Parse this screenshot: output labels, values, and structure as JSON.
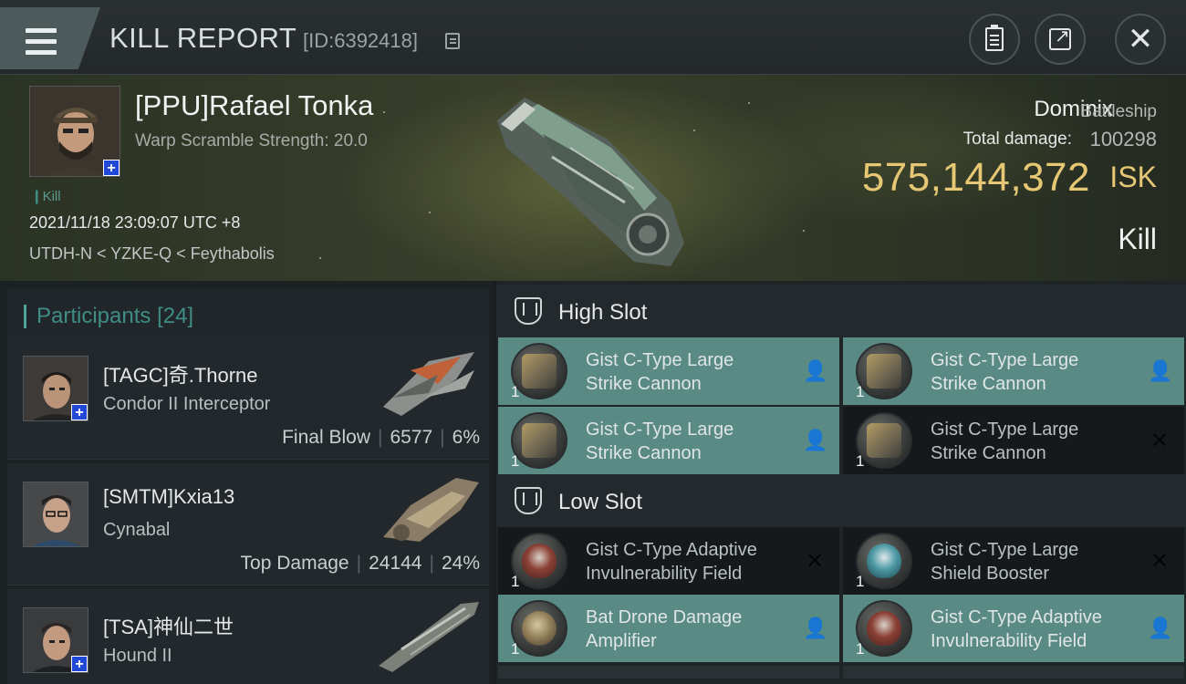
{
  "header": {
    "title": "KILL REPORT",
    "report_id": "[ID:6392418]",
    "menu_icon": "hamburger-menu-icon",
    "buttons": [
      "clipboard-icon",
      "share-icon",
      "close-icon"
    ]
  },
  "victim": {
    "name": "[PPU]Rafael Tonka",
    "warp_scramble": "Warp Scramble Strength: 20.0",
    "kill_tag": "Kill",
    "datetime": "2021/11/18 23:09:07 UTC +8",
    "location": "UTDH-N < YZKE-Q < Feythabolis",
    "ship_name": "Dominix",
    "ship_class": "Battleship",
    "total_damage_label": "Total damage:",
    "total_damage_value": "100298",
    "isk_value": "575,144,372",
    "isk_unit": "ISK",
    "result": "Kill"
  },
  "participants": {
    "label": "Participants",
    "count": "[24]",
    "rows": [
      {
        "name": "[TAGC]奇.Thorne",
        "ship": "Condor II Interceptor",
        "role": "Final Blow",
        "damage": "6577",
        "percent": "6%",
        "plus": true
      },
      {
        "name": "[SMTM]Kxia13",
        "ship": "Cynabal",
        "role": "Top Damage",
        "damage": "24144",
        "percent": "24%",
        "plus": false
      },
      {
        "name": "[TSA]神仙二世",
        "ship": "Hound II",
        "role": "",
        "damage": "",
        "percent": "",
        "plus": true
      }
    ]
  },
  "fitting": {
    "high_slot_title": "High Slot",
    "low_slot_title": "Low Slot",
    "high_slot": [
      {
        "line1": "Gist C-Type Large",
        "line2": "Strike Cannon",
        "qty": "1",
        "state": "active"
      },
      {
        "line1": "Gist C-Type Large",
        "line2": "Strike Cannon",
        "qty": "1",
        "state": "active"
      },
      {
        "line1": "Gist C-Type Large",
        "line2": "Strike Cannon",
        "qty": "1",
        "state": "active"
      },
      {
        "line1": "Gist C-Type Large",
        "line2": "Strike Cannon",
        "qty": "1",
        "state": "destroyed"
      }
    ],
    "low_slot": [
      {
        "line1": "Gist C-Type Adaptive",
        "line2": "Invulnerability Field",
        "qty": "1",
        "state": "destroyed"
      },
      {
        "line1": "Gist C-Type Large",
        "line2": "Shield Booster",
        "qty": "1",
        "state": "destroyed"
      },
      {
        "line1": "Bat Drone Damage",
        "line2": "Amplifier",
        "qty": "1",
        "state": "active"
      },
      {
        "line1": "Gist C-Type Adaptive",
        "line2": "Invulnerability Field",
        "qty": "1",
        "state": "active"
      }
    ]
  },
  "colors": {
    "accent_teal": "#5a8a84",
    "isk_gold": "#e6c774",
    "participants_teal": "#3f8d84"
  }
}
